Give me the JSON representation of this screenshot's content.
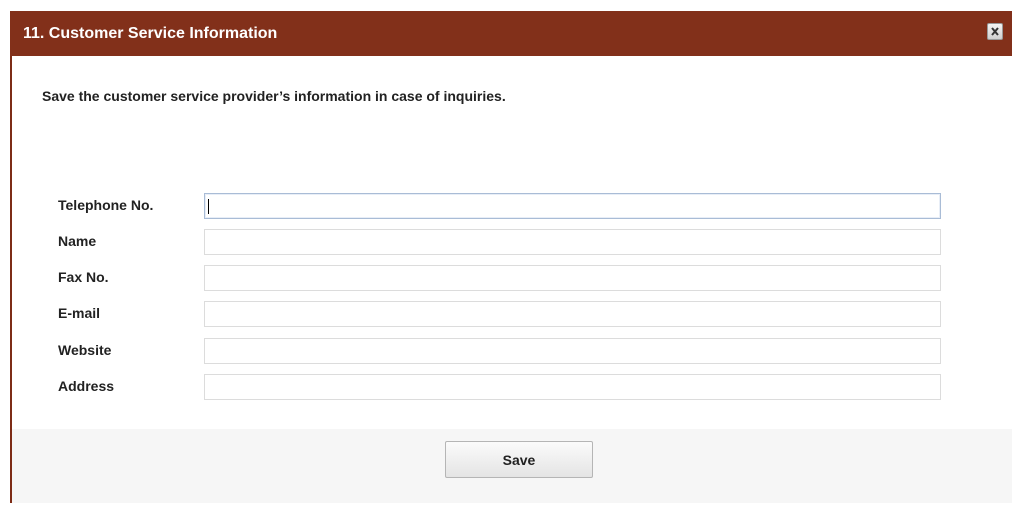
{
  "dialog": {
    "title": "11. Customer Service Information",
    "description": "Save the customer service provider’s information in case of inquiries.",
    "close_icon": "close-icon",
    "title_bar_color": "#82301a"
  },
  "form": {
    "fields": [
      {
        "key": "telephone",
        "label": "Telephone No.",
        "value": "",
        "focused": true
      },
      {
        "key": "name",
        "label": "Name",
        "value": ""
      },
      {
        "key": "fax",
        "label": "Fax No.",
        "value": ""
      },
      {
        "key": "email",
        "label": "E-mail",
        "value": ""
      },
      {
        "key": "website",
        "label": "Website",
        "value": ""
      },
      {
        "key": "address",
        "label": "Address",
        "value": ""
      }
    ]
  },
  "footer": {
    "save_label": "Save"
  }
}
